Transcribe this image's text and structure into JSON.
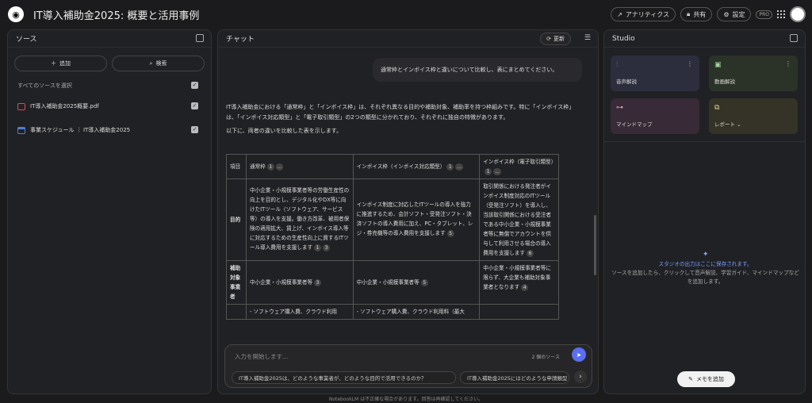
{
  "header": {
    "title": "IT導入補助金2025: 概要と活用事例",
    "analytics": "アナリティクス",
    "share": "共有",
    "settings": "設定",
    "pro": "PRO"
  },
  "sources": {
    "title": "ソース",
    "add": "追加",
    "search": "検索",
    "select_all": "すべてのソースを選択",
    "items": [
      {
        "label": "IT導入補助金2025概要.pdf",
        "color": "#d94c4c"
      },
      {
        "label": "事業スケジュール ｜ IT導入補助金2025",
        "color": "#4f7fd9"
      }
    ]
  },
  "chat": {
    "title": "チャット",
    "refresh": "更新",
    "user_question": "通常枠とインボイス枠と違いについて比較し、表にまとめてください。",
    "intro": "IT導入補助金における「通常枠」と「インボイス枠」は、それぞれ異なる目的や補助対象、補助率を持つ枠組みです。特に「インボイス枠」は、「インボイス対応類型」と「電子取引類型」の2つの類型に分かれており、それぞれに独自の特徴があります。",
    "intro2": "以下に、両者の違いを比較した表を示します。",
    "table": {
      "headers": [
        "項目",
        "通常枠",
        "インボイス枠（インボイス対応類型）",
        "インボイス枠（電子取引類型）"
      ],
      "rows": [
        {
          "label": "目的",
          "cells": [
            "中小企業・小規模事業者等の労働生産性の向上を目的とし、デジタル化やDX等に向けたITツール（ソフトウェア、サービス等）の導入を支援。働き方改革、被用者保険の適用拡大、賃上げ、インボイス導入等に対応するための生産性向上に資するITツール導入費用を支援します",
            "インボイス制度に対応したITツールの導入を強力に推進するため、会計ソフト・受発注ソフト・決済ソフトの導入費用に加え、PC・タブレット、レジ・券売機等の導入費用を支援します",
            "取引関係における発注者がインボイス制度対応のITツール（受発注ソフト）を導入し、当該取引関係における受注者である中小企業・小規模事業者等に無償でアカウントを供与して利用させる場合の導入費用を支援します"
          ]
        },
        {
          "label": "補助対象事業者",
          "cells": [
            "中小企業・小規模事業者等",
            "中小企業・小規模事業者等",
            "中小企業・小規模事業者等に限らず、大企業も補助対象事業者となります"
          ]
        },
        {
          "label": "",
          "cells": [
            "- ソフトウェア購入費、クラウド利用",
            "- ソフトウェア購入費、クラウド利用料（最大",
            ""
          ]
        }
      ],
      "cites": {
        "h1": "1",
        "h2": "1",
        "h3": "1",
        "more": "...",
        "r1c1": [
          "1",
          "3"
        ],
        "r1c2": "5",
        "r1c3": "6",
        "r2c1": "3",
        "r2c2": "5",
        "r2c3": "4"
      }
    },
    "input_placeholder": "入力を開始します...",
    "source_count": "2 個のソース",
    "suggestions": [
      "IT導入補助金2025は、どのような事業者が、どのような目的で活用できるのか？",
      "IT導入補助金2025にはどのような申請類型"
    ]
  },
  "studio": {
    "title": "Studio",
    "tiles": [
      {
        "label": "音声解説",
        "color": "#2c2e3d"
      },
      {
        "label": "動画解説",
        "color": "#2b3328"
      },
      {
        "label": "マインドマップ",
        "color": "#382a36"
      },
      {
        "label": "レポート",
        "color": "#353327"
      }
    ],
    "empty_title": "スタジオの出力はここに保存されます。",
    "empty_body": "ソースを追加したら、クリックして音声解説、学習ガイド、マインドマップなどを追加します。",
    "add_memo": "メモを追加"
  },
  "footer": "NotebookLM は不正確な場合があります。回答は再確認してください。"
}
